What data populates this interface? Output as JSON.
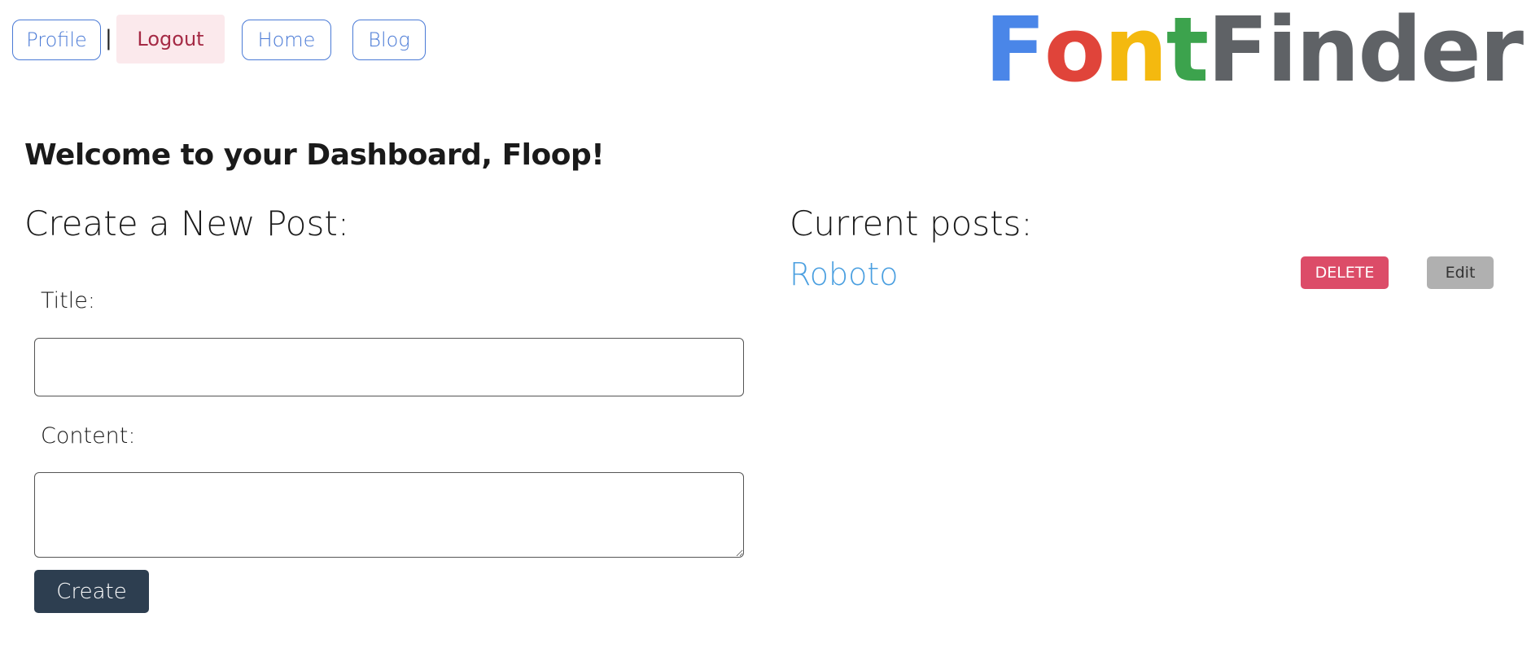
{
  "nav": {
    "profile_label": "Profile",
    "separator": "|",
    "logout_label": "Logout",
    "home_label": "Home",
    "blog_label": "Blog"
  },
  "logo": {
    "letters": [
      {
        "char": "F",
        "color": "#4a86e8"
      },
      {
        "char": "o",
        "color": "#e0443a"
      },
      {
        "char": "n",
        "color": "#f4b90f"
      },
      {
        "char": "t",
        "color": "#3ca34d"
      },
      {
        "char": "Finder",
        "color": "#5f6266"
      }
    ]
  },
  "dashboard": {
    "welcome": "Welcome to your Dashboard, Floop!"
  },
  "create_post": {
    "heading": "Create a New Post:",
    "title_label": "Title:",
    "title_value": "",
    "content_label": "Content:",
    "content_value": "",
    "create_label": "Create"
  },
  "current_posts": {
    "heading": "Current posts:",
    "posts": [
      {
        "title": "Roboto",
        "delete_label": "DELETE",
        "edit_label": "Edit"
      }
    ]
  },
  "colors": {
    "nav_accent": "#4a7ad6",
    "logout_text": "#a52a45",
    "logout_bg": "#fbe9ec",
    "create_bg": "#2d3e50",
    "post_link": "#4a9fe0",
    "delete_bg": "#dc4c68",
    "edit_bg": "#b0b0b0"
  }
}
